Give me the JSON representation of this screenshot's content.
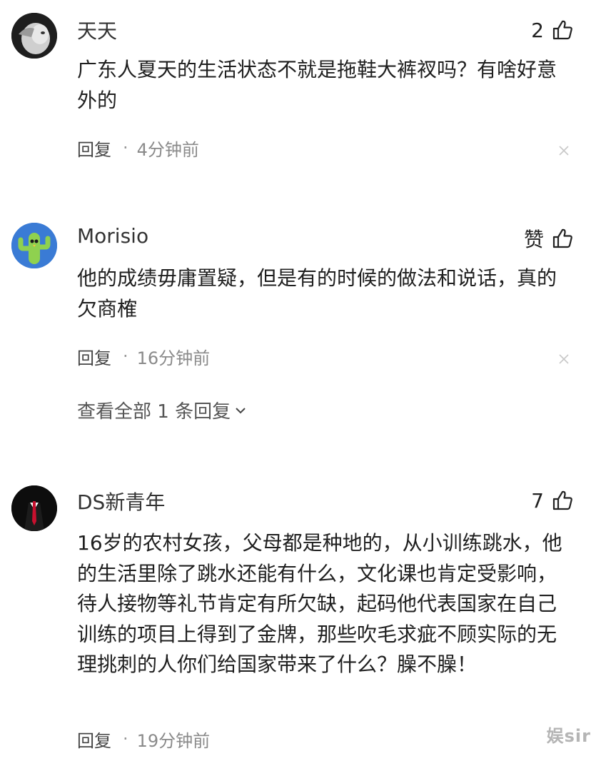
{
  "comments": [
    {
      "username": "天天",
      "like_label": "2",
      "text": "广东人夏天的生活状态不就是拖鞋大裤衩吗？有啥好意外的",
      "reply_label": "回复",
      "separator": "·",
      "time": "4分钟前",
      "avatar_icon": "cat-avatar-icon"
    },
    {
      "username": "Morisio",
      "like_label": "赞",
      "text": "他的成绩毋庸置疑，但是有的时候的做法和说话，真的欠商榷",
      "reply_label": "回复",
      "separator": "·",
      "time": "16分钟前",
      "view_replies": "查看全部 1 条回复",
      "avatar_icon": "cactus-avatar-icon"
    },
    {
      "username": "DS新青年",
      "like_label": "7",
      "text": "16岁的农村女孩，父母都是种地的，从小训练跳水，他的生活里除了跳水还能有什么，文化课也肯定受影响，待人接物等礼节肯定有所欠缺，起码他代表国家在自己训练的项目上得到了金牌，那些吹毛求疵不顾实际的无理挑刺的人你们给国家带来了什么？臊不臊！",
      "reply_label": "回复",
      "separator": "·",
      "time": "19分钟前",
      "avatar_icon": "suit-avatar-icon"
    }
  ],
  "watermark": "娱sir",
  "colors": {
    "text": "#1f1f1f",
    "meta": "#8a8a8a",
    "cactus": "#8fd14f",
    "avatar_bg": "#3a7bd5"
  }
}
